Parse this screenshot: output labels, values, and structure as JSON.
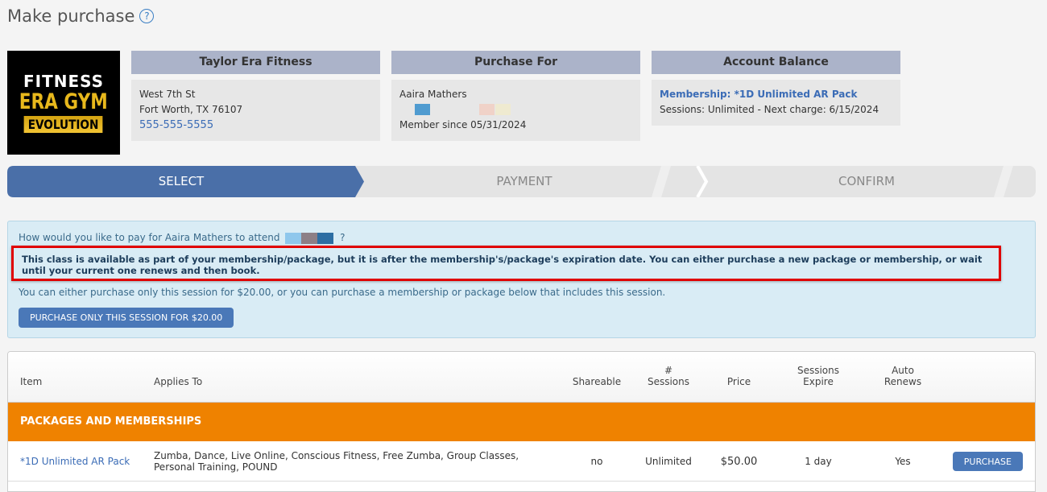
{
  "page_title": "Make purchase",
  "help_icon": "?",
  "logo": {
    "line1": "FITNESS",
    "line2": "ERA GYM",
    "line3": "EVOLUTION"
  },
  "studio": {
    "header": "Taylor Era Fitness",
    "street": "West 7th St",
    "city": "Fort Worth, TX 76107",
    "phone": "555-555-5555"
  },
  "purchase_for": {
    "header": "Purchase For",
    "name": "Aaira Mathers",
    "member_since": "Member since 05/31/2024"
  },
  "account_balance": {
    "header": "Account Balance",
    "membership": "Membership: *1D Unlimited AR Pack",
    "sessions": "Sessions: Unlimited -  Next charge: 6/15/2024"
  },
  "steps": [
    "SELECT",
    "PAYMENT",
    "CONFIRM"
  ],
  "info": {
    "question_prefix": "How would you like to pay for Aaira Mathers to attend",
    "question_suffix": "?",
    "alert": "This class is available as part of your membership/package, but it is after the membership's/package's expiration date. You can either purchase a new package or membership, or wait until your current one renews and then book.",
    "either": "You can either purchase only this session for $20.00, or you can purchase a membership or package below that includes this session.",
    "session_button": "PURCHASE ONLY THIS SESSION FOR $20.00"
  },
  "table": {
    "headers": {
      "item": "Item",
      "applies_to": "Applies To",
      "shareable": "Shareable",
      "sessions_1": "#",
      "sessions_2": "Sessions",
      "price": "Price",
      "expire_1": "Sessions",
      "expire_2": "Expire",
      "auto_1": "Auto",
      "auto_2": "Renews"
    },
    "group": "PACKAGES AND MEMBERSHIPS",
    "rows": [
      {
        "item": "*1D Unlimited AR Pack",
        "applies_to": "Zumba, Dance, Live Online, Conscious Fitness, Free Zumba, Group Classes, Personal Training, POUND",
        "shareable": "no",
        "sessions": "Unlimited",
        "price": "$50.00",
        "expire": "1 day",
        "auto_renews": "Yes",
        "button": "PURCHASE"
      }
    ]
  },
  "colors": {
    "accent": "#4a6fa8",
    "group_bar": "#ef8200",
    "alert_border": "#e00000",
    "info_bg": "#d9ecf5"
  }
}
